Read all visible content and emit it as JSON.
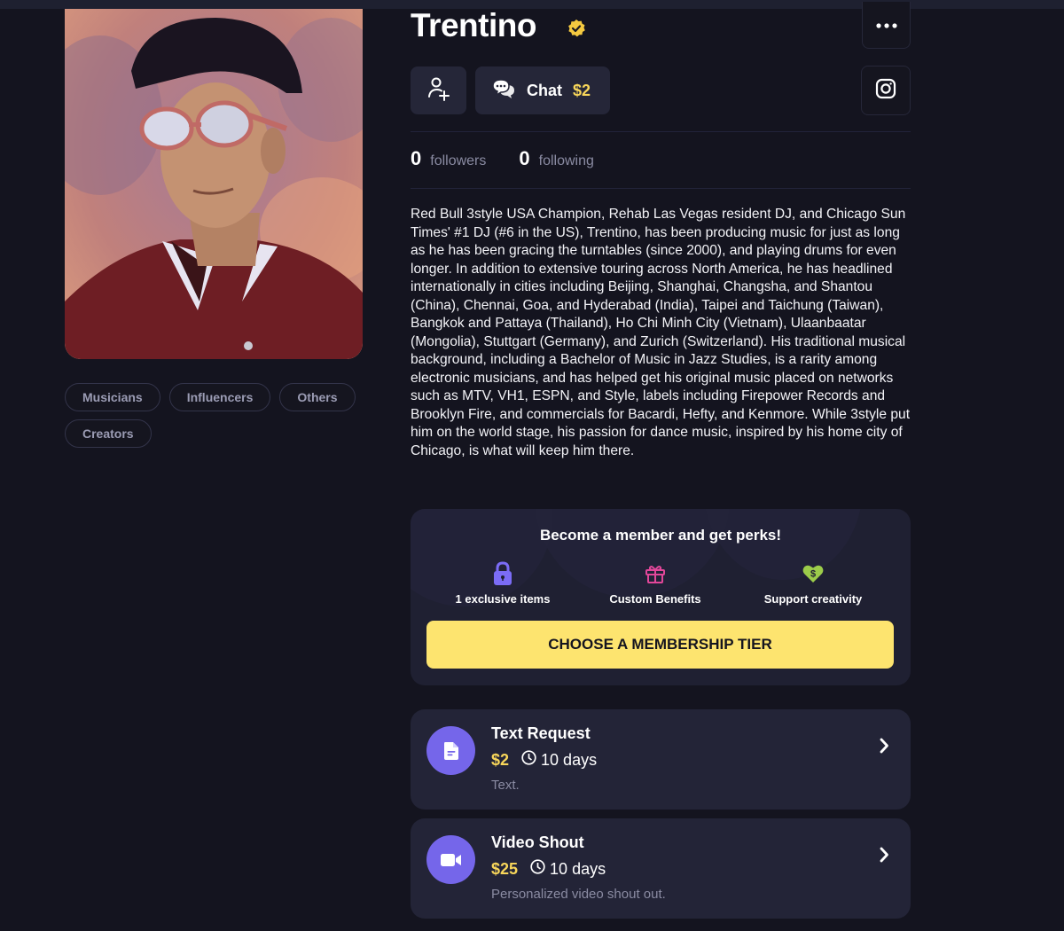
{
  "profile": {
    "name": "Trentino",
    "verified": true,
    "photo_alt": "Portrait of Trentino wearing a black cap, reflective sunglasses and a maroon varsity jacket against a pink cloudy sky",
    "tags": [
      "Musicians",
      "Influencers",
      "Others",
      "Creators"
    ]
  },
  "actions": {
    "follow_icon": "user-plus-icon",
    "chat_label": "Chat",
    "chat_price": "$2",
    "more_icon": "ellipsis-icon",
    "social_icon": "instagram-icon"
  },
  "stats": {
    "followers_count": "0",
    "followers_label": "followers",
    "following_count": "0",
    "following_label": "following"
  },
  "bio": "Red Bull 3style USA Champion, Rehab Las Vegas resident DJ, and Chicago Sun Times' #1 DJ (#6 in the US), Trentino, has been producing music for just as long as he has been gracing the turntables (since 2000), and playing drums for even longer. In addition to extensive touring across North America, he has headlined internationally in cities including Beijing, Shanghai, Changsha, and Shantou (China), Chennai, Goa, and Hyderabad (India), Taipei and Taichung (Taiwan), Bangkok and Pattaya (Thailand), Ho Chi Minh City (Vietnam), Ulaanbaatar (Mongolia), Stuttgart (Germany), and Zurich (Switzerland). His traditional musical background, including a Bachelor of Music in Jazz Studies, is a rarity among electronic musicians, and has helped get his original music placed on networks such as MTV, VH1, ESPN, and Style, labels including Firepower Records and Brooklyn Fire, and commercials for Bacardi, Hefty, and Kenmore. While 3style put him on the world stage, his passion for dance music, inspired by his home city of Chicago, is what will keep him there.",
  "membership": {
    "title": "Become a member and get perks!",
    "perks": [
      {
        "icon": "lock-icon",
        "label": "1 exclusive items",
        "color": "#7b6cf6"
      },
      {
        "icon": "gift-icon",
        "label": "Custom Benefits",
        "color": "#e2479a"
      },
      {
        "icon": "heart-dollar-icon",
        "label": "Support creativity",
        "color": "#9ccc4a"
      }
    ],
    "cta_label": "CHOOSE A MEMBERSHIP TIER"
  },
  "services": [
    {
      "icon": "document-icon",
      "title": "Text Request",
      "price": "$2",
      "duration": "10 days",
      "description": "Text."
    },
    {
      "icon": "video-camera-icon",
      "title": "Video Shout",
      "price": "$25",
      "duration": "10 days",
      "description": "Personalized video shout out."
    }
  ],
  "colors": {
    "background": "#14141f",
    "accent_yellow": "#f8d65a",
    "cta_yellow": "#fde46f",
    "accent_purple": "#7566ea",
    "card": "#232437"
  }
}
